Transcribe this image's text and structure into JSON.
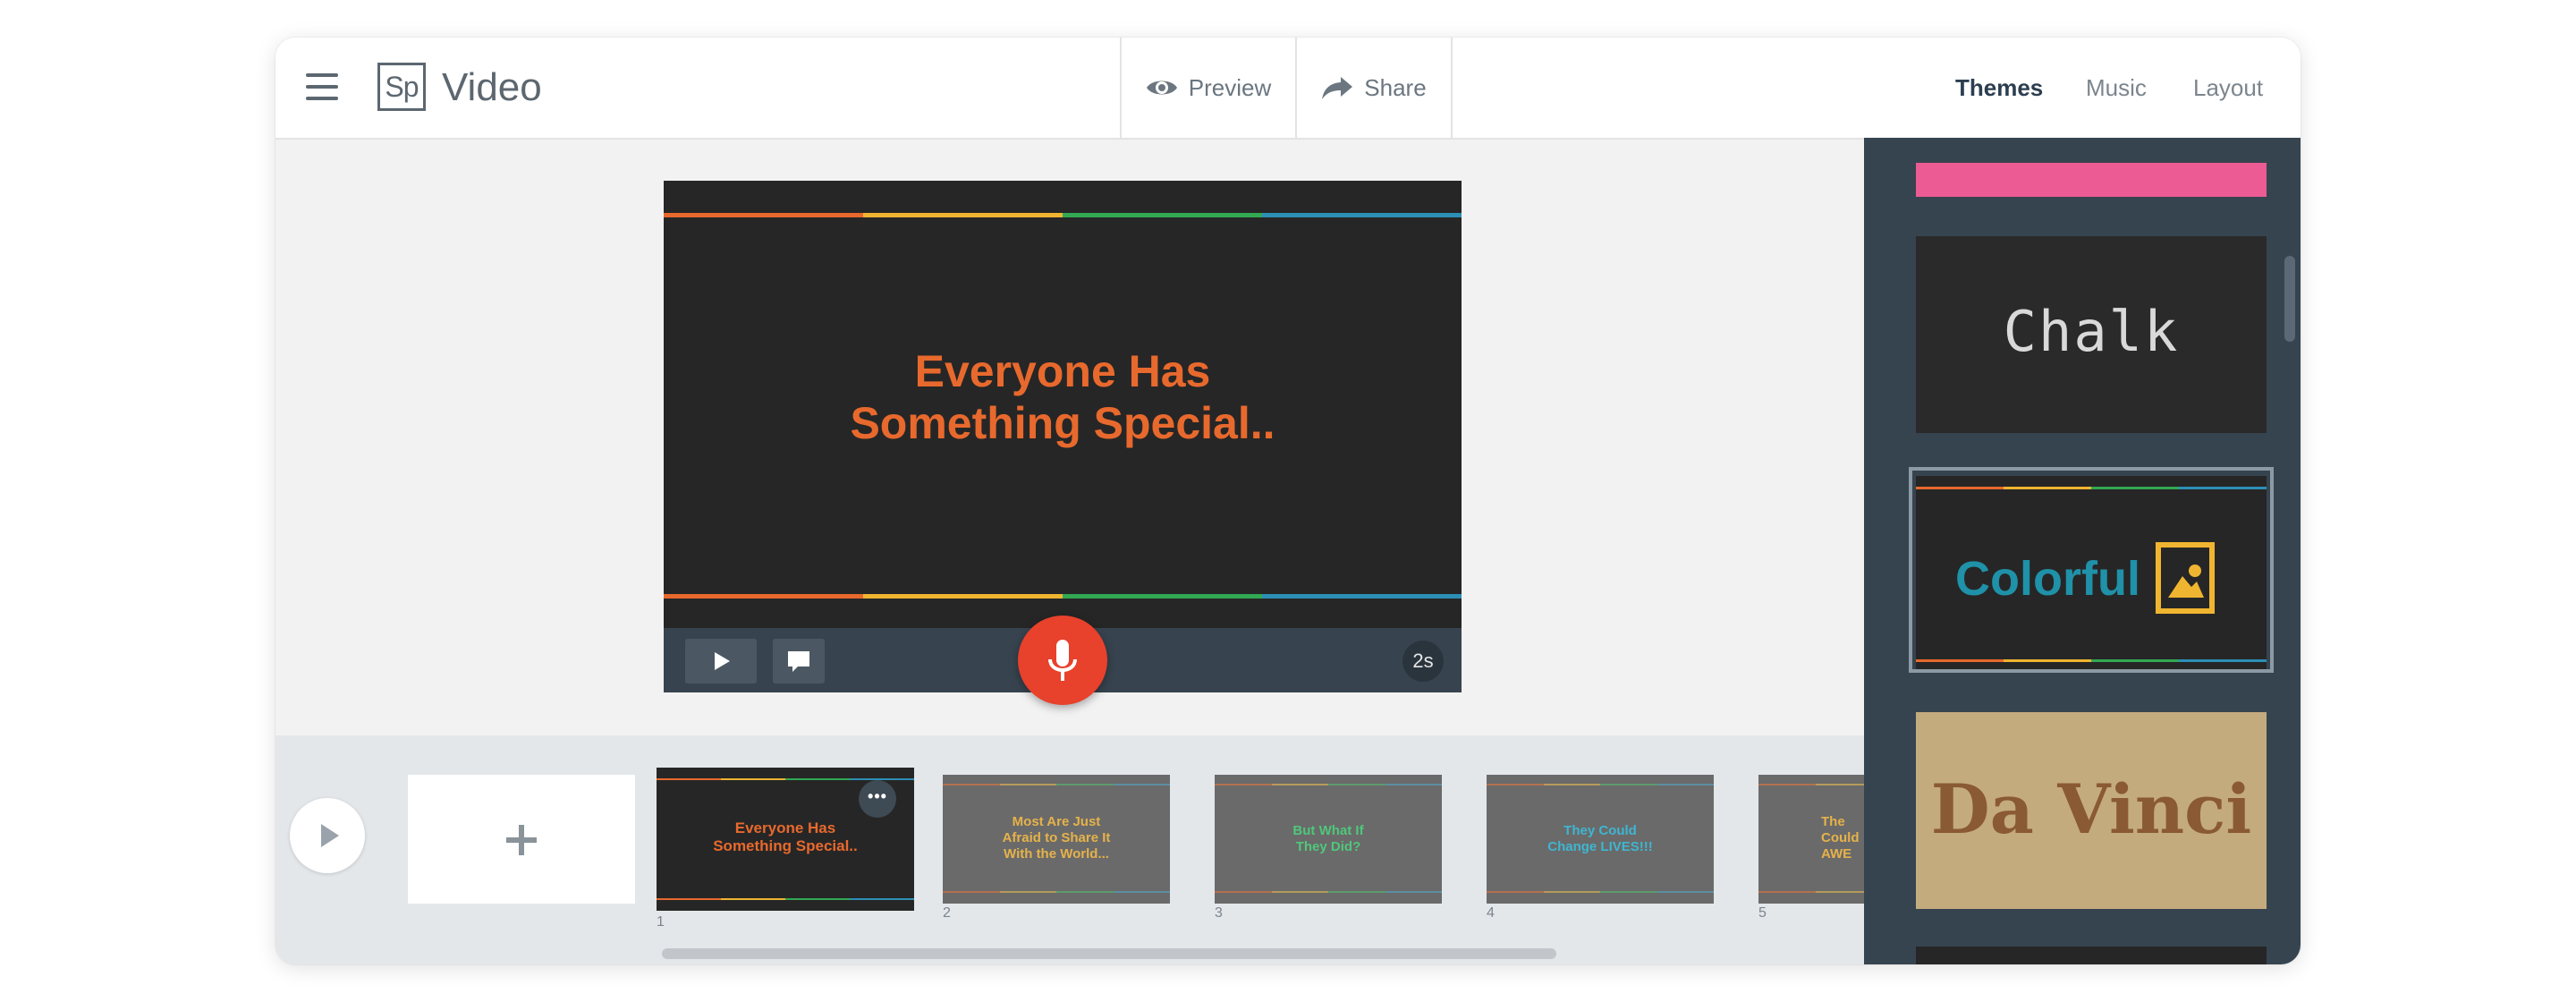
{
  "app": {
    "logo_mark": "Sp",
    "logo_text": "Video"
  },
  "header": {
    "preview_label": "Preview",
    "share_label": "Share",
    "tabs": [
      {
        "label": "Themes",
        "active": true
      },
      {
        "label": "Music",
        "active": false
      },
      {
        "label": "Layout",
        "active": false
      }
    ]
  },
  "stage": {
    "slide_title_line1": "Everyone Has",
    "slide_title_line2": "Something Special..",
    "duration": "2s"
  },
  "filmstrip": {
    "add_symbol": "+",
    "slides": [
      {
        "number": "1",
        "line1": "Everyone Has",
        "line2": "Something Special..",
        "line3": "",
        "color": "#e8692d",
        "selected": true
      },
      {
        "number": "2",
        "line1": "Most Are Just",
        "line2": "Afraid to Share It",
        "line3": "With the World...",
        "color": "#f0b530",
        "selected": false
      },
      {
        "number": "3",
        "line1": "But What If",
        "line2": "They Did?",
        "line3": "",
        "color": "#32a853",
        "selected": false
      },
      {
        "number": "4",
        "line1": "They Could",
        "line2": "Change LIVES!!!",
        "line3": "",
        "color": "#2c8fb5",
        "selected": false
      },
      {
        "number": "5",
        "line1": "The",
        "line2": "Could",
        "line3": "AWE",
        "color": "#f0b530",
        "selected": false
      }
    ],
    "more_label": "•••"
  },
  "themes": [
    {
      "name": "Chalk"
    },
    {
      "name": "Colorful",
      "selected": true
    },
    {
      "name": "Da Vinci"
    }
  ],
  "colors": {
    "accent_mic": "#e8412c",
    "panel_bg": "#36444f",
    "stripe": [
      "#e8692d",
      "#f0b530",
      "#32a853",
      "#2c8fb5"
    ]
  },
  "icons": [
    "menu-icon",
    "eye-icon",
    "share-arrow-icon",
    "play-icon",
    "comment-icon",
    "microphone-icon",
    "plus-icon",
    "more-icon",
    "image-icon"
  ]
}
